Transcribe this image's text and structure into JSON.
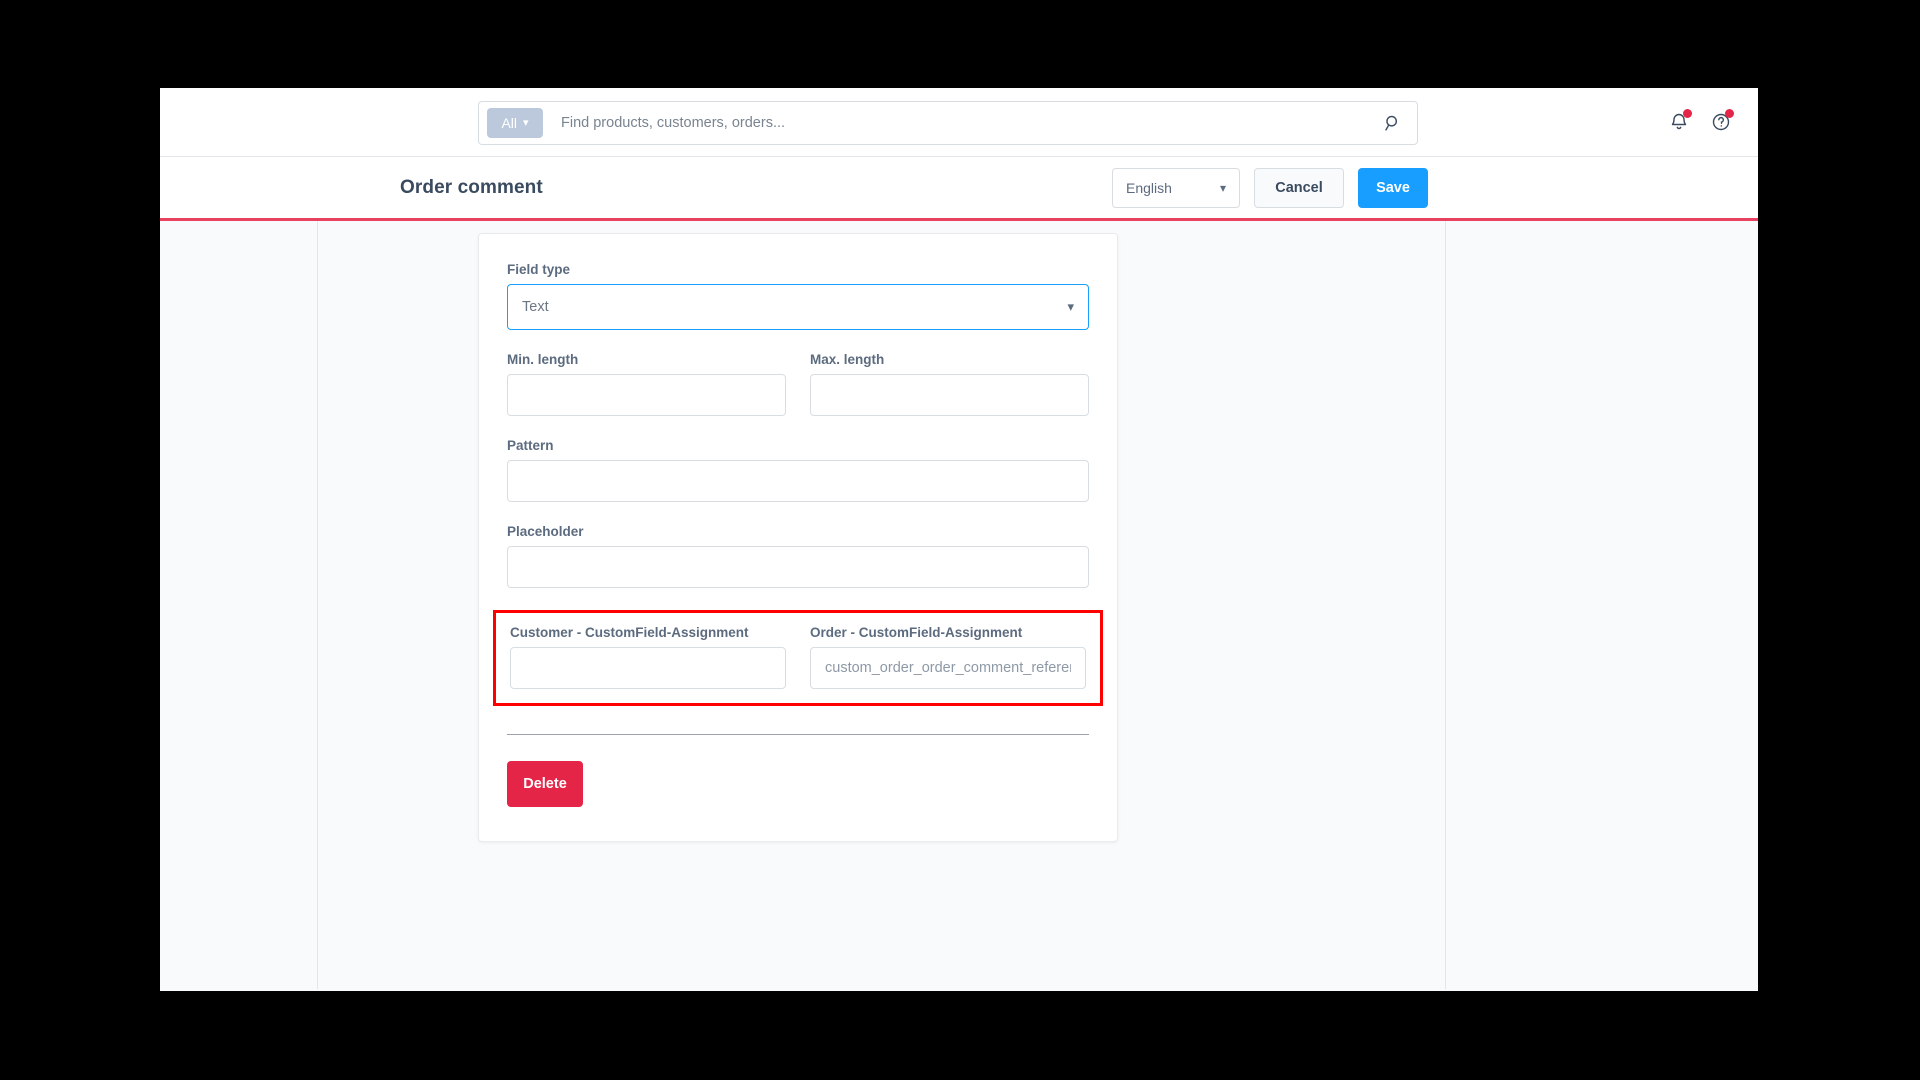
{
  "topbar": {
    "scope_label": "All",
    "search_placeholder": "Find products, customers, orders...",
    "search_value": "",
    "search_icon": "search-icon",
    "notifications_icon": "bell-icon",
    "help_icon": "question-circle-icon"
  },
  "smartbar": {
    "title": "Order comment",
    "language": "English",
    "cancel_label": "Cancel",
    "save_label": "Save"
  },
  "form": {
    "field_type": {
      "label": "Field type",
      "value": "Text"
    },
    "min_length": {
      "label": "Min. length",
      "value": ""
    },
    "max_length": {
      "label": "Max. length",
      "value": ""
    },
    "pattern": {
      "label": "Pattern",
      "value": ""
    },
    "placeholder_field": {
      "label": "Placeholder",
      "value": ""
    },
    "customer_assignment": {
      "label": "Customer - CustomField-Assignment",
      "value": "",
      "placeholder": ""
    },
    "order_assignment": {
      "label": "Order - CustomField-Assignment",
      "value": "",
      "placeholder": "custom_order_order_comment_reference"
    },
    "delete_label": "Delete"
  },
  "colors": {
    "accent_blue": "#189eff",
    "danger_red": "#e52548",
    "smartbar_underline": "#e8405f",
    "highlight_outline": "#fe0000",
    "chip_blue_gray": "#bcc9dc",
    "page_bg": "#f9fafb"
  }
}
